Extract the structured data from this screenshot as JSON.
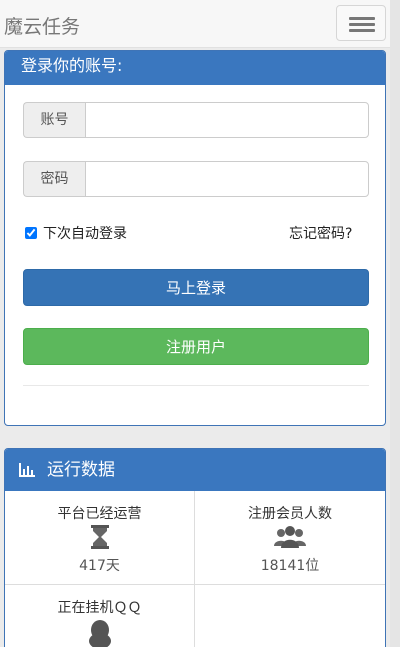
{
  "navbar": {
    "brand": "魔云任务",
    "menu_icon": "hamburger-icon"
  },
  "login": {
    "heading": "登录你的账号:",
    "account_label": "账号",
    "account_value": "",
    "account_placeholder": "",
    "password_label": "密码",
    "password_value": "",
    "password_placeholder": "",
    "remember_label": "下次自动登录",
    "remember_checked": true,
    "forgot_label": "忘记密码?",
    "login_button": "马上登录",
    "register_button": "注册用户"
  },
  "stats": {
    "heading": "运行数据",
    "heading_icon": "bar-chart-icon",
    "items": [
      {
        "label": "平台已经运营",
        "icon": "hourglass-icon",
        "value": "417天"
      },
      {
        "label": "注册会员人数",
        "icon": "users-icon",
        "value": "18141位"
      },
      {
        "label": "正在挂机ＱＱ",
        "icon": "qq-penguin-icon",
        "value": ""
      },
      {
        "label": "",
        "icon": "",
        "value": ""
      }
    ]
  },
  "colors": {
    "primary": "#3a77bf",
    "success": "#5cb85c",
    "navbar": "#f7f7f7",
    "background": "#ebebeb"
  }
}
